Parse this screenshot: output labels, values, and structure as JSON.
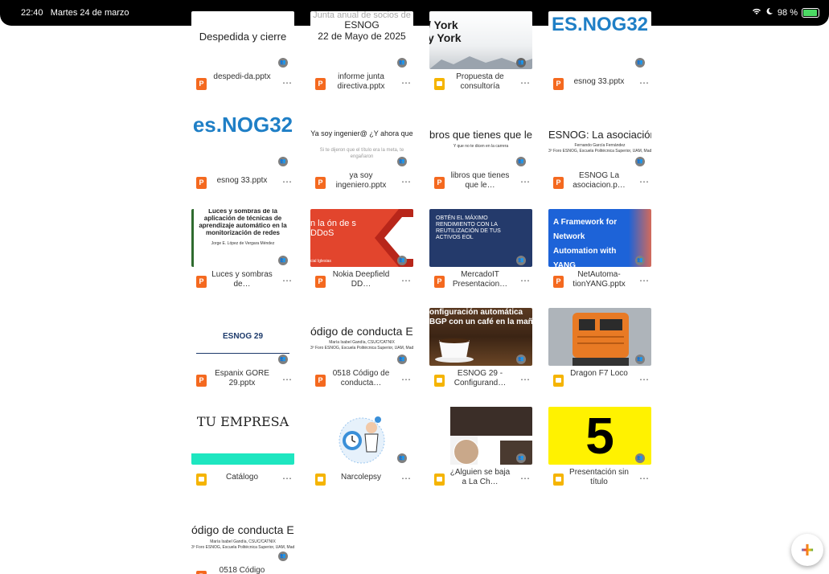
{
  "status": {
    "time": "22:40",
    "date": "Martes 24 de marzo",
    "battery": "98 %"
  },
  "files": [
    {
      "name": "despedi-da.pptx",
      "type": "pptx",
      "thumb": {
        "title": "Despedida y cierre"
      }
    },
    {
      "name": "informe junta directiva.pptx",
      "type": "pptx",
      "thumb": {
        "top": "Junta anual de socios de",
        "title": "ESNOG",
        "sub": "22 de Mayo de 2025"
      }
    },
    {
      "name": "Propuesta de consultoría",
      "type": "slides",
      "thumb": {
        "title": "/ York",
        "sub": "y York"
      }
    },
    {
      "name": "esnog 33.pptx",
      "type": "pptx",
      "thumb": {
        "logo": "ES.NOG32"
      }
    },
    {
      "name": "esnog 33.pptx",
      "type": "pptx",
      "thumb": {
        "logo": "es.NOG32"
      }
    },
    {
      "name": "ya soy ingeniero.pptx",
      "type": "pptx",
      "thumb": {
        "title": "Ya soy ingenier@ ¿Y ahora que",
        "sub": "Si te dijeron que el título era la meta, te engañaron"
      }
    },
    {
      "name": "libros que tienes que le…",
      "type": "pptx",
      "thumb": {
        "title": "bros que tienes que le",
        "sub": "Y que no te dicen en la carrera"
      }
    },
    {
      "name": "ESNOG La asociacion.p…",
      "type": "pptx",
      "thumb": {
        "title": "ESNOG: La asociación",
        "sub": "Fernando García Fernández",
        "sub2": "3º Foro ESNOG, Escuela Politécnica Superior, UAM, Mad"
      }
    },
    {
      "name": "Luces y sombras de…",
      "type": "pptx",
      "thumb": {
        "title": "Luces y sombras de la aplicación de técnicas de aprendizaje automático en la monitorización de redes",
        "sub": "Jorge E. López de Vergara Méndez"
      }
    },
    {
      "name": "Nokia Deepfield DD…",
      "type": "pptx",
      "thumb": {
        "title": "n la ón de s DDoS",
        "sub": "cial Iglesias"
      }
    },
    {
      "name": "MercadoIT Presentacion…",
      "type": "pptx",
      "thumb": {
        "title": "OBTÉN EL MÁXIMO RENDIMIENTO CON LA REUTILIZACIÓN DE TUS ACTIVOS EOL"
      }
    },
    {
      "name": "NetAutoma-tionYANG.pptx",
      "type": "pptx",
      "thumb": {
        "title": "A Framework for Network Automation with YANG"
      }
    },
    {
      "name": "Espanix GORE 29.pptx",
      "type": "pptx",
      "thumb": {
        "title": "ESNOG 29"
      }
    },
    {
      "name": "0518 Código de conducta…",
      "type": "pptx",
      "thumb": {
        "title": "ódigo de conducta ESN",
        "sub": "María Isabel Gandía, CSUC/CATNIX",
        "sub2": "3º Foro ESNOG, Escuela Politécnica Superior, UAM, Mad"
      }
    },
    {
      "name": "ESNOG 29 - Configurand…",
      "type": "slides",
      "thumb": {
        "title": "onfiguración automática BGP con un café en la mañ"
      }
    },
    {
      "name": "Dragon F7 Loco",
      "type": "slides",
      "thumb": {}
    },
    {
      "name": "Catálogo",
      "type": "slides",
      "thumb": {
        "title": "TU EMPRESA"
      }
    },
    {
      "name": "Narcolepsy",
      "type": "slides",
      "thumb": {}
    },
    {
      "name": "¿Alguien se baja a La Ch…",
      "type": "slides",
      "thumb": {}
    },
    {
      "name": "Presentación sin título",
      "type": "slides",
      "thumb": {
        "title": "5"
      }
    },
    {
      "name": "0518 Código",
      "type": "pptx",
      "thumb": {
        "title": "ódigo de conducta ESN",
        "sub": "María Isabel Gandía, CSUC/CATNIX",
        "sub2": "3º Foro ESNOG, Escuela Politécnica Superior, UAM, Mad"
      }
    }
  ],
  "icons": {
    "more": "⋯",
    "shared": "people-icon",
    "fab": "+"
  }
}
